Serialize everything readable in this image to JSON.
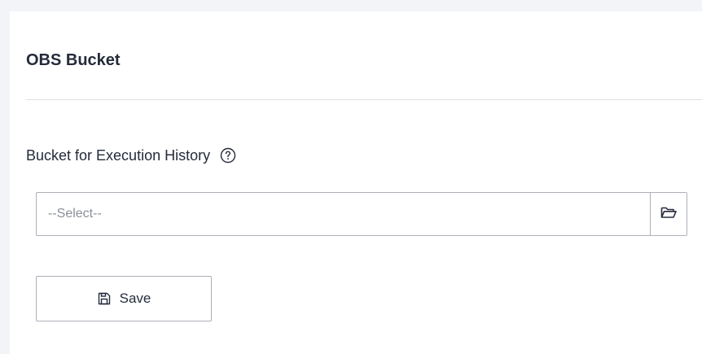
{
  "section": {
    "title": "OBS Bucket"
  },
  "field": {
    "label": "Bucket for Execution History",
    "help_icon": "question-circle-icon",
    "placeholder": "--Select--",
    "browse_icon": "folder-open-icon"
  },
  "actions": {
    "save_label": "Save",
    "save_icon": "save-disk-icon"
  },
  "colors": {
    "page_background": "#f3f4f7",
    "panel_background": "#ffffff",
    "text": "#252b3a",
    "placeholder": "#8a8e99",
    "border": "#adb0b8",
    "divider": "#dfe1e6"
  }
}
